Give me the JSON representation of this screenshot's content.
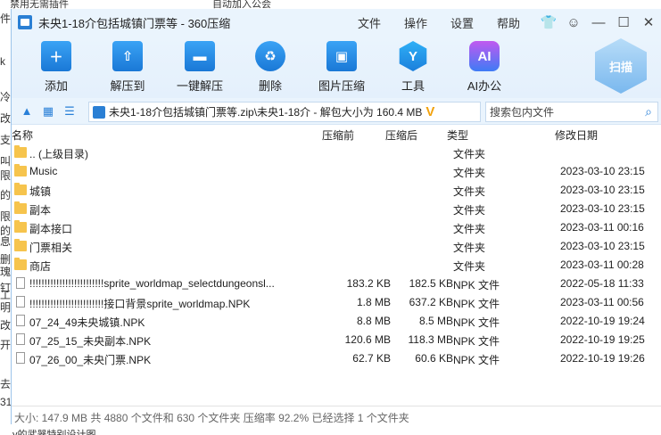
{
  "background": {
    "top_left_text": "及禁用无需插件",
    "top_mid_text": "自动加入公会",
    "left_chars": [
      "件",
      "k",
      "冷",
      "改",
      "支",
      "叫",
      "限",
      "的",
      "限",
      "的",
      "息",
      "删",
      "瑰",
      "钉",
      "工",
      "明",
      "改",
      "开",
      "去",
      "31"
    ],
    "bottom_text": "y的武器特别设计图"
  },
  "window": {
    "title": "未央1-18介包括城镇门票等 - 360压缩",
    "menu": [
      "文件",
      "操作",
      "设置",
      "帮助"
    ],
    "controls": [
      "shirt",
      "chat",
      "minimize",
      "maximize",
      "close"
    ]
  },
  "toolbar": {
    "tools": [
      {
        "label": "添加",
        "icon": "add-icon"
      },
      {
        "label": "解压到",
        "icon": "extract-to-icon"
      },
      {
        "label": "一键解压",
        "icon": "one-click-extract-icon"
      },
      {
        "label": "删除",
        "icon": "delete-icon"
      },
      {
        "label": "图片压缩",
        "icon": "image-compress-icon"
      },
      {
        "label": "工具",
        "icon": "tools-icon"
      },
      {
        "label": "AI办公",
        "icon": "ai-office-icon"
      }
    ],
    "scan_label": "扫描"
  },
  "pathbar": {
    "path": "未央1-18介包括城镇门票等.zip\\未央1-18介 - 解包大小为 160.4 MB",
    "search_placeholder": "搜索包内文件"
  },
  "columns": {
    "name": "名称",
    "packed": "压缩前",
    "unpacked": "压缩后",
    "type": "类型",
    "modified": "修改日期"
  },
  "rows": [
    {
      "name": ".. (上级目录)",
      "before": "",
      "after": "",
      "type": "文件夹",
      "date": "",
      "kind": "folder"
    },
    {
      "name": "Music",
      "before": "",
      "after": "",
      "type": "文件夹",
      "date": "2023-03-10 23:15",
      "kind": "folder"
    },
    {
      "name": "城镇",
      "before": "",
      "after": "",
      "type": "文件夹",
      "date": "2023-03-10 23:15",
      "kind": "folder"
    },
    {
      "name": "副本",
      "before": "",
      "after": "",
      "type": "文件夹",
      "date": "2023-03-10 23:15",
      "kind": "folder"
    },
    {
      "name": "副本接口",
      "before": "",
      "after": "",
      "type": "文件夹",
      "date": "2023-03-11 00:16",
      "kind": "folder"
    },
    {
      "name": "门票相关",
      "before": "",
      "after": "",
      "type": "文件夹",
      "date": "2023-03-10 23:15",
      "kind": "folder"
    },
    {
      "name": "商店",
      "before": "",
      "after": "",
      "type": "文件夹",
      "date": "2023-03-11 00:28",
      "kind": "folder"
    },
    {
      "name": "!!!!!!!!!!!!!!!!!!!!!!!!!sprite_worldmap_selectdungeonsl...",
      "before": "183.2 KB",
      "after": "182.5 KB",
      "type": "NPK 文件",
      "date": "2022-05-18 11:33",
      "kind": "file"
    },
    {
      "name": "!!!!!!!!!!!!!!!!!!!!!!!!!接口背景sprite_worldmap.NPK",
      "before": "1.8 MB",
      "after": "637.2 KB",
      "type": "NPK 文件",
      "date": "2023-03-11 00:56",
      "kind": "file"
    },
    {
      "name": "07_24_49未央城镇.NPK",
      "before": "8.8 MB",
      "after": "8.5 MB",
      "type": "NPK 文件",
      "date": "2022-10-19 19:24",
      "kind": "file"
    },
    {
      "name": "07_25_15_未央副本.NPK",
      "before": "120.6 MB",
      "after": "118.3 MB",
      "type": "NPK 文件",
      "date": "2022-10-19 19:25",
      "kind": "file"
    },
    {
      "name": "07_26_00_未央门票.NPK",
      "before": "62.7 KB",
      "after": "60.6 KB",
      "type": "NPK 文件",
      "date": "2022-10-19 19:26",
      "kind": "file"
    }
  ],
  "status": "大小: 147.9 MB 共 4880 个文件和 630 个文件夹 压缩率 92.2% 已经选择 1 个文件夹"
}
